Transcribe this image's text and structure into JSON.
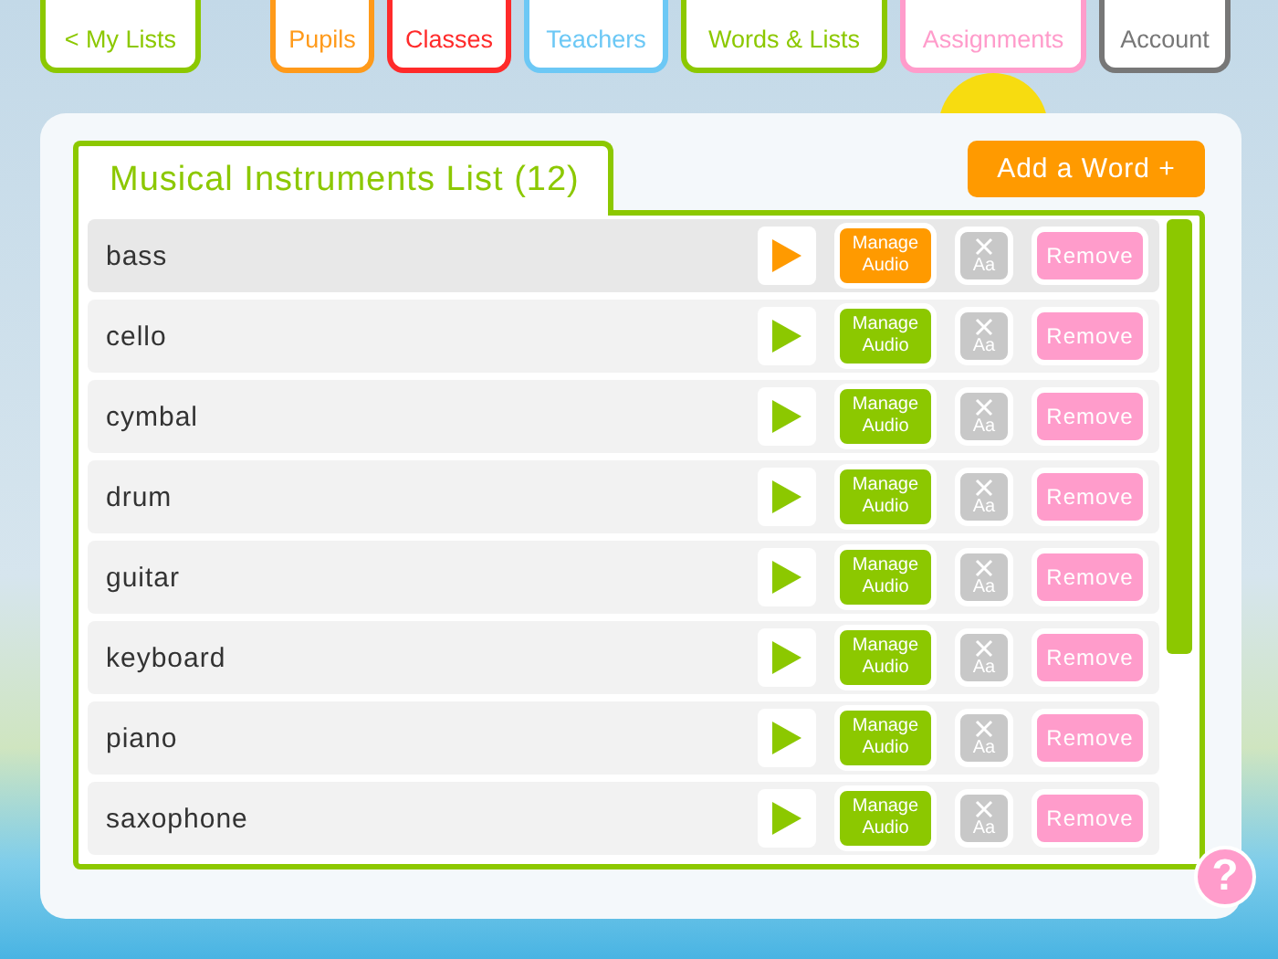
{
  "nav": [
    {
      "label": "< My Lists",
      "color": "#8cc800"
    },
    {
      "label": "Pupils",
      "color": "#ff9a1a"
    },
    {
      "label": "Classes",
      "color": "#ff2a2a"
    },
    {
      "label": "Teachers",
      "color": "#6cc8f5"
    },
    {
      "label": "Words & Lists",
      "color": "#8cc800"
    },
    {
      "label": "Assignments",
      "color": "#ff9ccb"
    },
    {
      "label": "Account",
      "color": "#777777"
    }
  ],
  "list": {
    "title": "Musical Instruments List (12)",
    "add_button": "Add a Word +",
    "words": [
      {
        "word": "bass",
        "selected": true,
        "manage": "Manage Audio",
        "case": "Aa",
        "remove": "Remove"
      },
      {
        "word": "cello",
        "selected": false,
        "manage": "Manage Audio",
        "case": "Aa",
        "remove": "Remove"
      },
      {
        "word": "cymbal",
        "selected": false,
        "manage": "Manage Audio",
        "case": "Aa",
        "remove": "Remove"
      },
      {
        "word": "drum",
        "selected": false,
        "manage": "Manage Audio",
        "case": "Aa",
        "remove": "Remove"
      },
      {
        "word": "guitar",
        "selected": false,
        "manage": "Manage Audio",
        "case": "Aa",
        "remove": "Remove"
      },
      {
        "word": "keyboard",
        "selected": false,
        "manage": "Manage Audio",
        "case": "Aa",
        "remove": "Remove"
      },
      {
        "word": "piano",
        "selected": false,
        "manage": "Manage Audio",
        "case": "Aa",
        "remove": "Remove"
      },
      {
        "word": "saxophone",
        "selected": false,
        "manage": "Manage Audio",
        "case": "Aa",
        "remove": "Remove"
      }
    ]
  },
  "help": "?"
}
